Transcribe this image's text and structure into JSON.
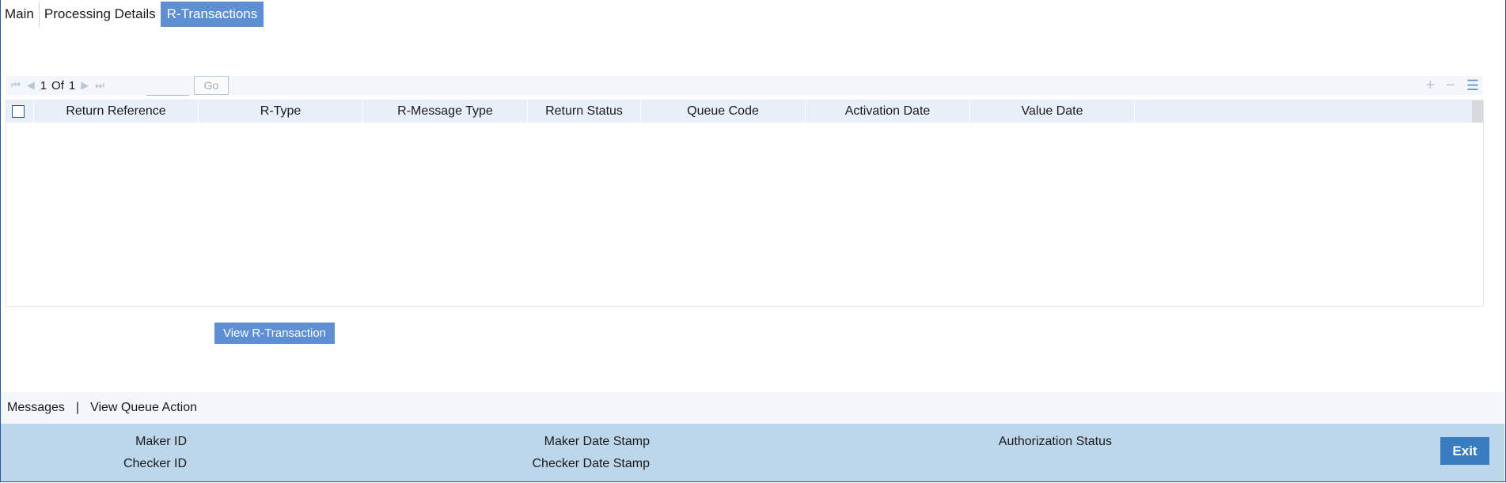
{
  "tabs": [
    {
      "label": "Main"
    },
    {
      "label": "Processing Details"
    },
    {
      "label": "R-Transactions",
      "active": true
    }
  ],
  "pager": {
    "current": "1",
    "of_label": "Of",
    "total": "1",
    "go_label": "Go",
    "goto_value": ""
  },
  "toolbar_icons": [
    "add-row-icon",
    "delete-row-icon",
    "single-view-icon"
  ],
  "grid": {
    "columns": [
      "Return Reference",
      "R-Type",
      "R-Message Type",
      "Return Status",
      "Queue Code",
      "Activation Date",
      "Value Date"
    ],
    "rows": []
  },
  "actions": {
    "view_r_transaction": "View R-Transaction"
  },
  "links": {
    "messages": "Messages",
    "separator": "|",
    "view_queue_action": "View Queue Action"
  },
  "footer": {
    "maker_id": "Maker ID",
    "checker_id": "Checker ID",
    "maker_date_stamp": "Maker Date Stamp",
    "checker_date_stamp": "Checker Date Stamp",
    "authorization_status": "Authorization Status",
    "exit": "Exit"
  },
  "colors": {
    "accent": "#5f8fd3",
    "footer_bg": "#bcd6ec",
    "exit_bg": "#3a7cc0"
  }
}
